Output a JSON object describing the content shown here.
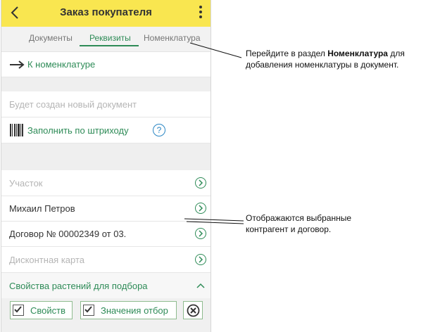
{
  "app": {
    "title": "Заказ покупателя",
    "back_glyph": "<",
    "tabs": [
      "Документы",
      "Реквизиты",
      "Номенклатура"
    ]
  },
  "content": {
    "to_nomenclature_link": "К номенклатуре",
    "new_document_note": "Будет создан новый документ",
    "fill_by_barcode_link": "Заполнить по штриходу",
    "help_glyph": "?",
    "fields": [
      {
        "value": "Участок"
      },
      {
        "value": "Михаил Петров"
      },
      {
        "value": "Договор № 00002349 от 03."
      },
      {
        "value": "Дисконтная карта"
      }
    ],
    "plant_props_header": "Свойства растений для подбора",
    "buttons": {
      "properties": "Свойств",
      "values": "Значения отбор"
    }
  },
  "callouts": {
    "top_line1_prefix": "Перейдите в раздел ",
    "top_line1_bold": "Номенклатура",
    "top_line1_suffix": " для",
    "top_line2": "добавления номенклатуры в документ.",
    "mid_line1": "Отображаются выбранные",
    "mid_line2": "контрагент и договор."
  },
  "colors": {
    "appbar": "#f9e650",
    "accent_green": "#2e8b57",
    "help_blue": "#2a86c4"
  }
}
